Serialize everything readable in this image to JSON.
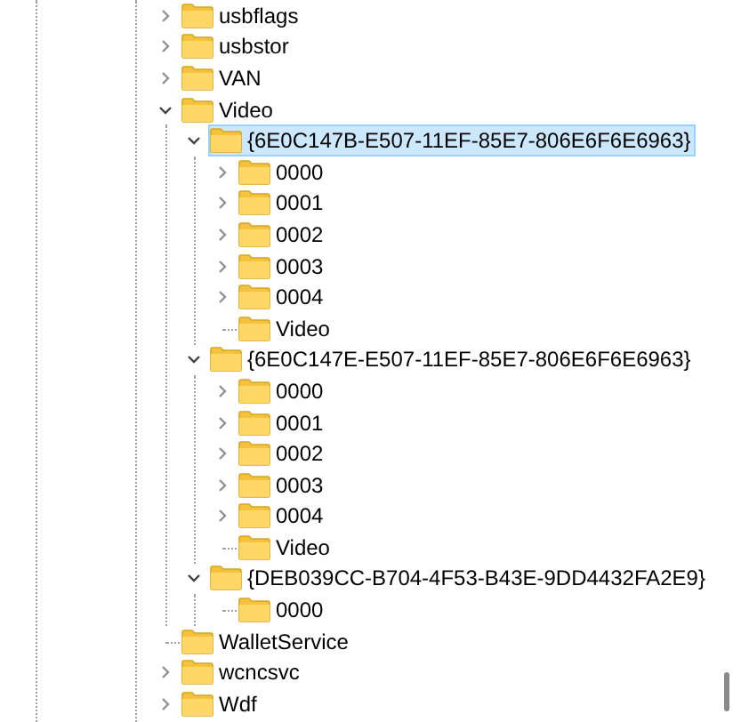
{
  "tree": [
    {
      "name": "usbflags",
      "expanded": false,
      "selected": false
    },
    {
      "name": "usbstor",
      "expanded": false,
      "selected": false
    },
    {
      "name": "VAN",
      "expanded": false,
      "selected": false
    },
    {
      "name": "Video",
      "expanded": true,
      "selected": false,
      "children": [
        {
          "name": "{6E0C147B-E507-11EF-85E7-806E6F6E6963}",
          "expanded": true,
          "selected": true,
          "children": [
            {
              "name": "0000",
              "expanded": false,
              "selected": false
            },
            {
              "name": "0001",
              "expanded": false,
              "selected": false
            },
            {
              "name": "0002",
              "expanded": false,
              "selected": false
            },
            {
              "name": "0003",
              "expanded": false,
              "selected": false
            },
            {
              "name": "0004",
              "expanded": false,
              "selected": false
            },
            {
              "name": "Video",
              "selected": false
            }
          ]
        },
        {
          "name": "{6E0C147E-E507-11EF-85E7-806E6F6E6963}",
          "expanded": true,
          "selected": false,
          "children": [
            {
              "name": "0000",
              "expanded": false,
              "selected": false
            },
            {
              "name": "0001",
              "expanded": false,
              "selected": false
            },
            {
              "name": "0002",
              "expanded": false,
              "selected": false
            },
            {
              "name": "0003",
              "expanded": false,
              "selected": false
            },
            {
              "name": "0004",
              "expanded": false,
              "selected": false
            },
            {
              "name": "Video",
              "selected": false
            }
          ]
        },
        {
          "name": "{DEB039CC-B704-4F53-B43E-9DD4432FA2E9}",
          "expanded": true,
          "selected": false,
          "children": [
            {
              "name": "0000",
              "selected": false
            }
          ]
        }
      ]
    },
    {
      "name": "WalletService",
      "selected": false
    },
    {
      "name": "wcncsvc",
      "expanded": false,
      "selected": false
    },
    {
      "name": "Wdf",
      "expanded": false,
      "selected": false
    }
  ]
}
